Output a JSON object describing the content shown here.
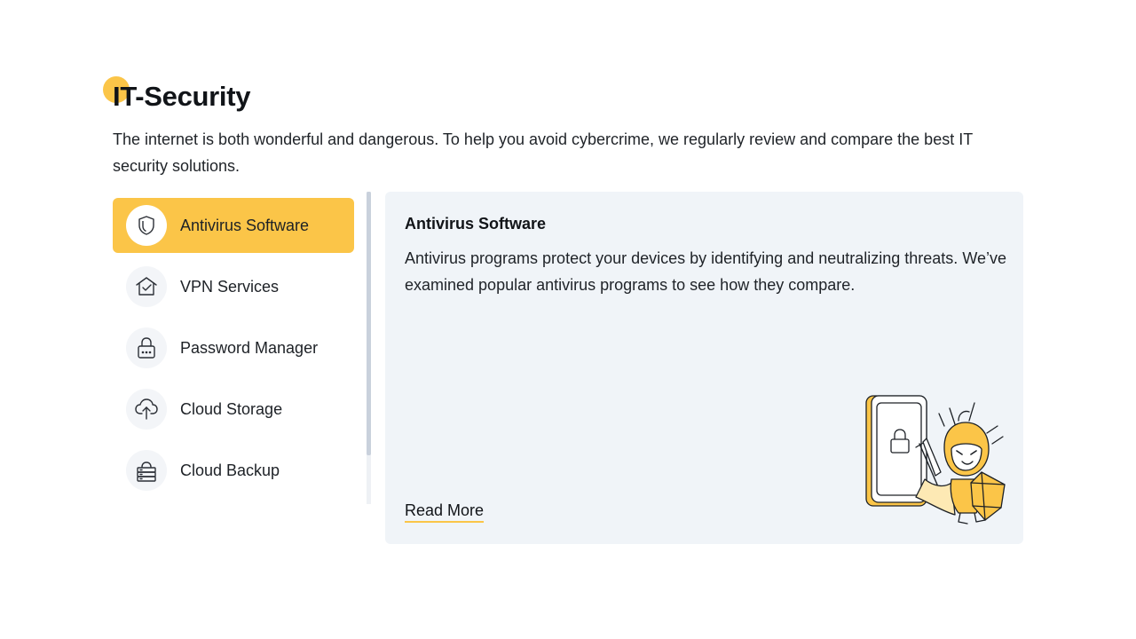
{
  "header": {
    "title": "IT-Security",
    "intro": "The internet is both wonderful and dangerous. To help you avoid cybercrime, we regularly review and compare the best IT security solutions."
  },
  "sidebar": {
    "items": [
      {
        "label": "Antivirus Software",
        "icon": "shield-icon",
        "active": true
      },
      {
        "label": "VPN Services",
        "icon": "house-check-icon",
        "active": false
      },
      {
        "label": "Password Manager",
        "icon": "padlock-icon",
        "active": false
      },
      {
        "label": "Cloud Storage",
        "icon": "cloud-upload-icon",
        "active": false
      },
      {
        "label": "Cloud Backup",
        "icon": "cloud-server-icon",
        "active": false
      }
    ]
  },
  "panel": {
    "title": "Antivirus Software",
    "text": "Antivirus programs protect your devices by identifying and neutralizing threats. We’ve examined popular antivirus programs to see how they compare.",
    "link": "Read More"
  },
  "colors": {
    "accent": "#fbc548",
    "panel_bg": "#f0f4f8",
    "text": "#1f2328"
  }
}
